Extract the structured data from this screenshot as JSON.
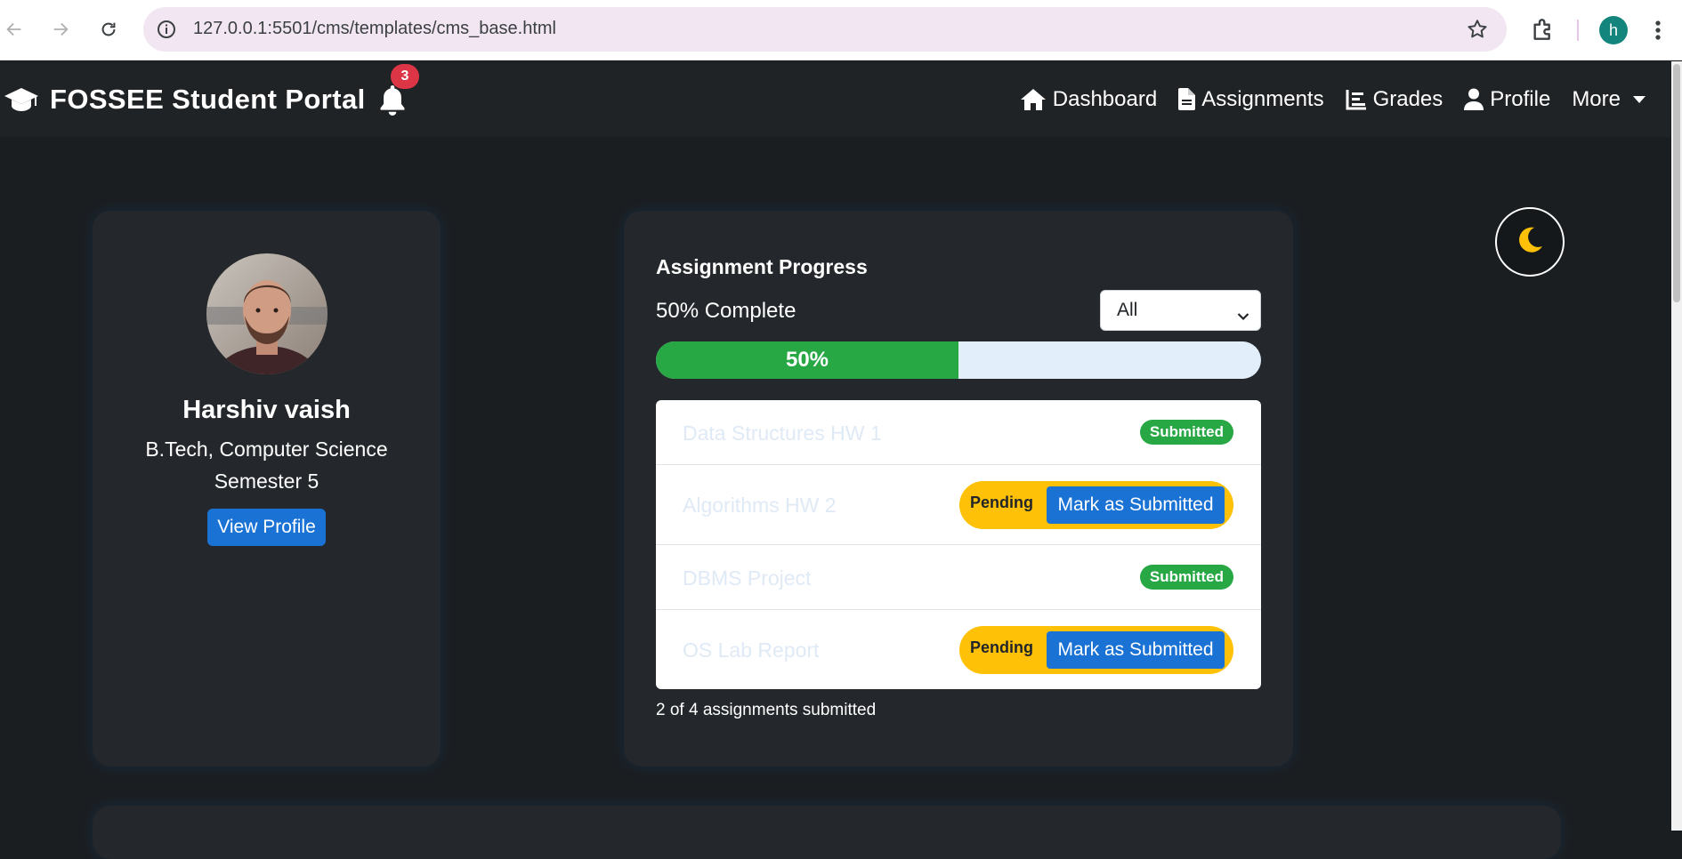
{
  "browser": {
    "url": "127.0.0.1:5501/cms/templates/cms_base.html",
    "profile_initial": "h"
  },
  "navbar": {
    "brand": "FOSSEE Student Portal",
    "notification_count": "3",
    "links": [
      {
        "label": "Dashboard",
        "icon": "home-icon"
      },
      {
        "label": "Assignments",
        "icon": "file-icon"
      },
      {
        "label": "Grades",
        "icon": "chart-icon"
      },
      {
        "label": "Profile",
        "icon": "user-icon"
      },
      {
        "label": "More",
        "icon": "caret-down-icon"
      }
    ]
  },
  "profile": {
    "name": "Harshiv vaish",
    "program": "B.Tech, Computer Science",
    "semester": "Semester 5",
    "view_profile_label": "View Profile"
  },
  "progress": {
    "title": "Assignment Progress",
    "status": "50% Complete",
    "filter_selected": "All",
    "percent": 50,
    "percent_label": "50%",
    "summary": "2 of 4 assignments submitted"
  },
  "assignments": [
    {
      "title": "Data Structures HW 1",
      "status": "Submitted"
    },
    {
      "title": "Algorithms HW 2",
      "status": "Pending",
      "action": "Mark as Submitted"
    },
    {
      "title": "DBMS Project",
      "status": "Submitted"
    },
    {
      "title": "OS Lab Report",
      "status": "Pending",
      "action": "Mark as Submitted"
    }
  ],
  "colors": {
    "accent": "#1a73d4",
    "success": "#28a745",
    "warning": "#ffc107",
    "danger": "#dc3545",
    "background": "#1b1e21",
    "card": "#24282c"
  },
  "theme_toggle": {
    "icon": "moon-icon"
  }
}
